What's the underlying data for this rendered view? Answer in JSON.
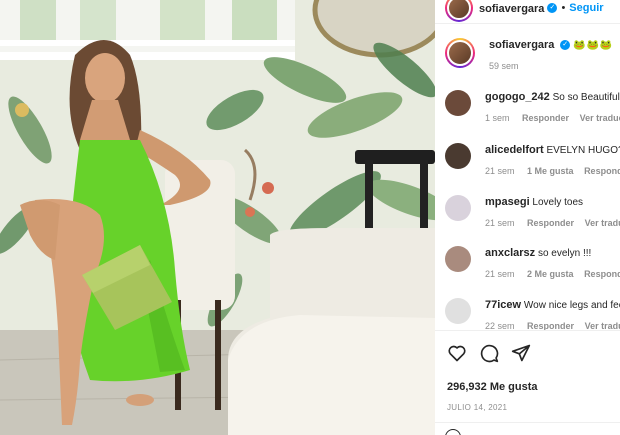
{
  "post": {
    "author": "sofiavergara",
    "follow_label": "Seguir",
    "caption_emoji": "🐸🐸🐸",
    "caption_time": "59 sem",
    "likes": "296,932 Me gusta",
    "date": "JULIO 14, 2021"
  },
  "comments": [
    {
      "user": "gogogo_242",
      "text": "So so Beautiful",
      "time": "1 sem",
      "reply": "Responder",
      "translate": "Ver traducción",
      "likes": "",
      "avatar_color": "#6b4a3a"
    },
    {
      "user": "alicedelfort",
      "text": "EVELYN HUGO?",
      "time": "21 sem",
      "reply": "Responder",
      "translate": "",
      "likes": "1 Me gusta",
      "avatar_color": "#4a3a30"
    },
    {
      "user": "mpasegi",
      "text": "Lovely toes",
      "time": "21 sem",
      "reply": "Responder",
      "translate": "Ver traducción",
      "likes": "",
      "avatar_color": "#d9d2dc"
    },
    {
      "user": "anxclarsz",
      "text": "so evelyn !!!",
      "time": "21 sem",
      "reply": "Responder",
      "translate": "",
      "likes": "2 Me gusta",
      "avatar_color": "#a98b7e"
    },
    {
      "user": "77icew",
      "text": "Wow nice legs and feet",
      "time": "22 sem",
      "reply": "Responder",
      "translate": "Ver traducción",
      "likes": "",
      "avatar_color": "#e0e0e0"
    }
  ],
  "icons": {
    "like": "heart-icon",
    "comment": "comment-icon",
    "share": "share-icon"
  }
}
